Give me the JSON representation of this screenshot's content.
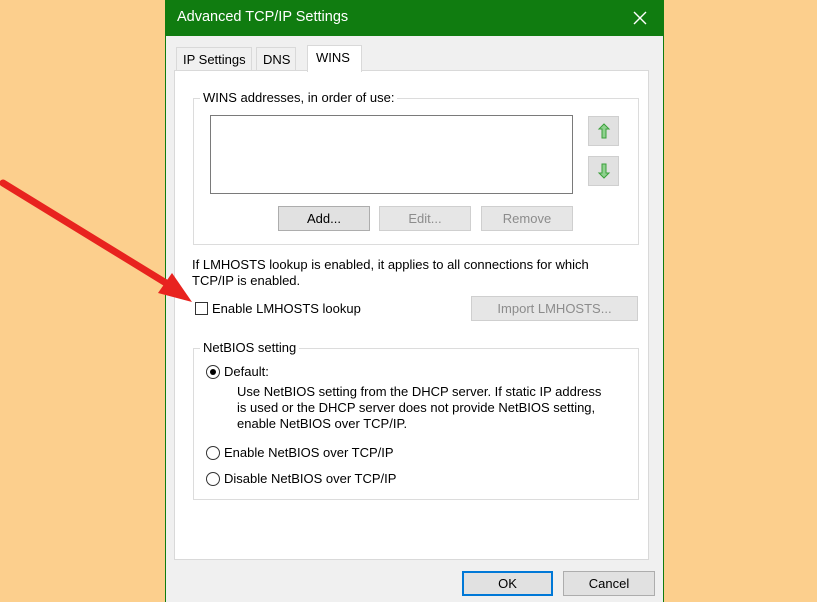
{
  "window": {
    "title": "Advanced TCP/IP Settings"
  },
  "tabs": [
    {
      "label": "IP Settings",
      "active": false
    },
    {
      "label": "DNS",
      "active": false
    },
    {
      "label": "WINS",
      "active": true
    }
  ],
  "wins": {
    "group_label": "WINS addresses, in order of use:",
    "addresses": [],
    "add_label": "Add...",
    "edit_label": "Edit...",
    "remove_label": "Remove",
    "up_icon": "arrow-up-icon",
    "down_icon": "arrow-down-icon"
  },
  "lmhosts": {
    "info_line1": "If LMHOSTS lookup is enabled, it applies to all connections for which",
    "info_line2": "TCP/IP is enabled.",
    "checkbox_label": "Enable LMHOSTS lookup",
    "checked": false,
    "import_label": "Import LMHOSTS..."
  },
  "netbios": {
    "group_label": "NetBIOS setting",
    "default_label": "Default:",
    "default_desc_line1": "Use NetBIOS setting from the DHCP server. If static IP address",
    "default_desc_line2": "is used or the DHCP server does not provide NetBIOS setting,",
    "default_desc_line3": "enable NetBIOS over TCP/IP.",
    "enable_label": "Enable NetBIOS over TCP/IP",
    "disable_label": "Disable NetBIOS over TCP/IP",
    "selected": "default"
  },
  "footer": {
    "ok_label": "OK",
    "cancel_label": "Cancel"
  },
  "colors": {
    "background": "#fccf8d",
    "titlebar": "#107c10",
    "annotation_arrow": "#e8231f",
    "arrow_icon": "#3aa03a"
  }
}
